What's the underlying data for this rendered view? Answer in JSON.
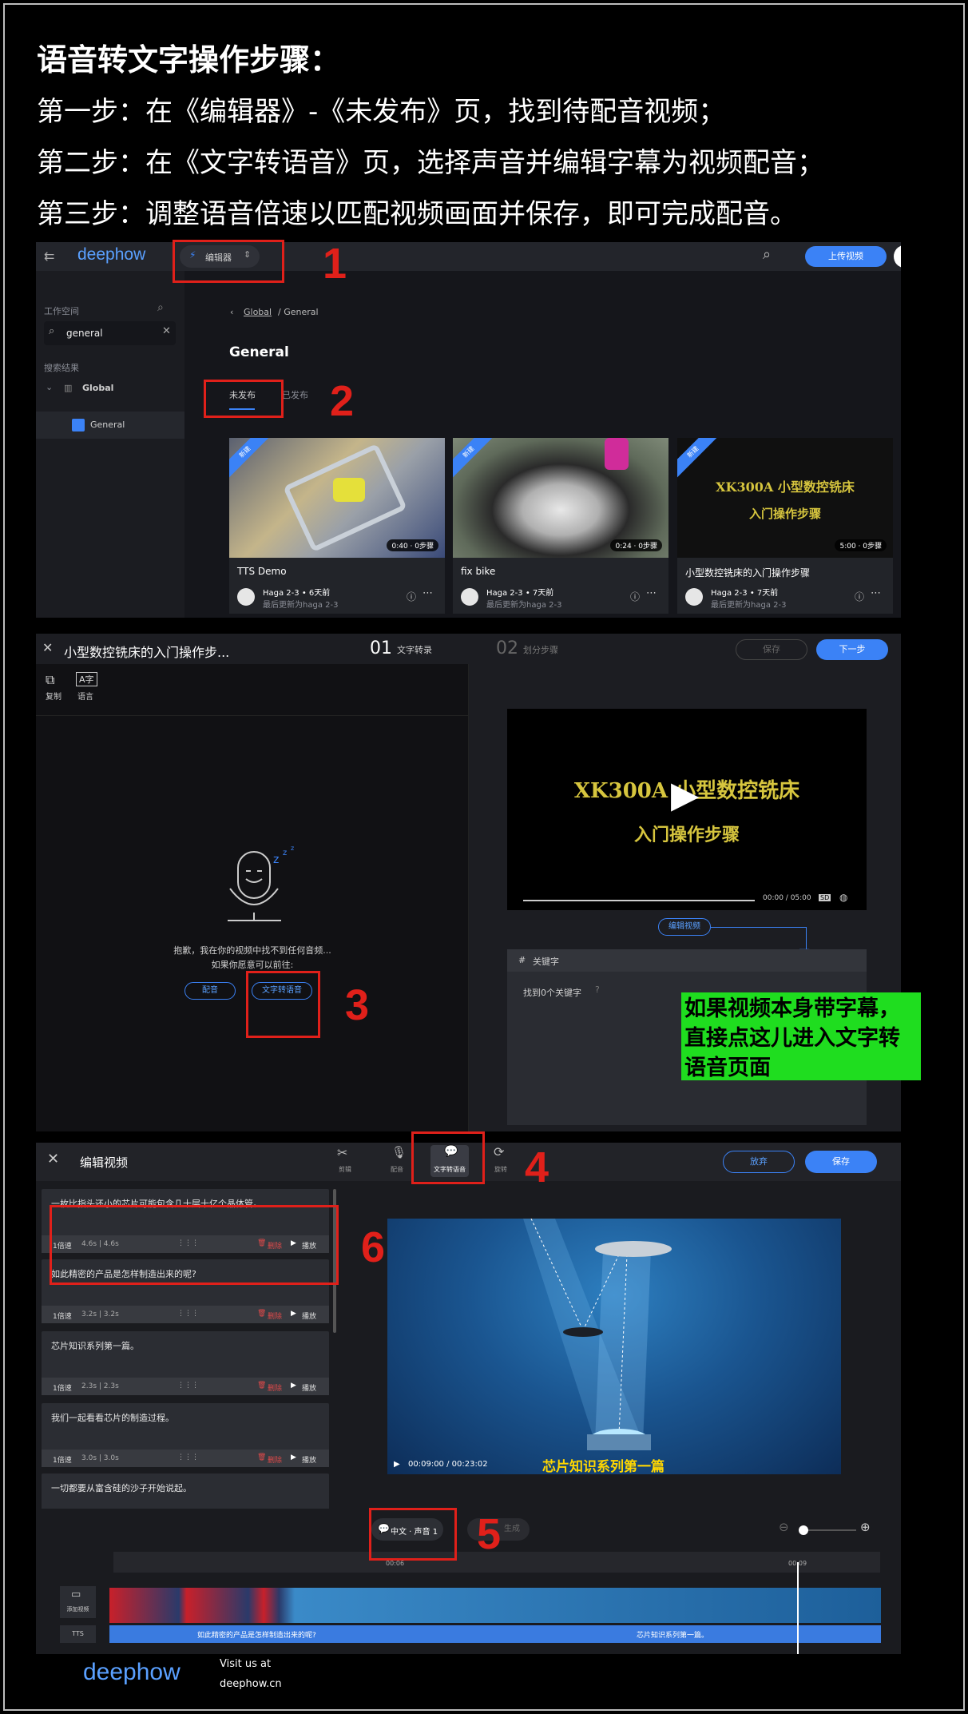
{
  "header": {
    "title": "语音转文字操作步骤：",
    "steps": [
      "第一步：在《编辑器》-《未发布》页，找到待配音视频；",
      "第二步：在《文字转语音》页，选择声音并编辑字幕为视频配音；",
      "第三步：调整语音倍速以匹配视频画面并保存，即可完成配音。"
    ]
  },
  "callouts": [
    "1",
    "2",
    "3",
    "4",
    "5",
    "6"
  ],
  "shot1": {
    "logo": "deephow",
    "editor_label": "编辑器",
    "upload_label": "上传视频",
    "workspace_label": "工作空间",
    "search_value": "general",
    "results_label": "搜索结果",
    "tree_global": "Global",
    "tree_general": "General",
    "breadcrumb_root": "Global",
    "breadcrumb_leaf": "/ General",
    "page_title": "General",
    "tab_unpublished": "未发布",
    "tab_published": "已发布",
    "cards": [
      {
        "title": "TTS Demo",
        "duration": "0:40 · 0步骤",
        "meta1": "Haga 2-3 • 6天前",
        "meta2": "最后更新为haga 2-3",
        "ribbon": "新建"
      },
      {
        "title": "fix bike",
        "duration": "0:24 · 0步骤",
        "meta1": "Haga 2-3 • 7天前",
        "meta2": "最后更新为haga 2-3",
        "ribbon": "新建"
      },
      {
        "title": "小型数控铣床的入门操作步骤",
        "duration": "5:00 · 0步骤",
        "meta1": "Haga 2-3 • 7天前",
        "meta2": "最后更新为haga 2-3",
        "ribbon": "新建",
        "thumb_line1": "XK300A 小型数控铣床",
        "thumb_line2": "入门操作步骤"
      }
    ]
  },
  "shot2": {
    "title": "小型数控铣床的入门操作步...",
    "step1_num": "01",
    "step1_label": "文字转录",
    "step2_num": "02",
    "step2_label": "划分步骤",
    "save_label": "保存",
    "next_label": "下一步",
    "copy_label": "复制",
    "lang_label": "语言",
    "empty_line1": "抱歉，我在你的视频中找不到任何音频...",
    "empty_line2": "如果你愿意可以前往:",
    "dub_label": "配音",
    "tts_label": "文字转语音",
    "video_line1": "XK300A 小型数控铣床",
    "video_line2": "入门操作步骤",
    "video_time": "00:00 / 05:00",
    "edit_video_label": "编辑视频",
    "keywords_title": "关键字",
    "keywords_found": "找到0个关键字"
  },
  "green_note": "如果视频本身带字幕，直接点这儿进入文字转语音页面",
  "shot3": {
    "title": "编辑视频",
    "tools": [
      "剪辑",
      "配音",
      "文字转语音",
      "旋转"
    ],
    "discard_label": "放弃",
    "save_label": "保存",
    "segments": [
      {
        "text": "一枚比指头还小的芯片可能包含几十层十亿个晶体管。",
        "speed": "1倍速",
        "dur": "4.6s | 4.6s"
      },
      {
        "text": "如此精密的产品是怎样制造出来的呢?",
        "speed": "1倍速",
        "dur": "3.2s | 3.2s"
      },
      {
        "text": "芯片知识系列第一篇。",
        "speed": "1倍速",
        "dur": "2.3s | 2.3s"
      },
      {
        "text": "我们一起看看芯片的制造过程。",
        "speed": "1倍速",
        "dur": "3.0s | 3.0s"
      },
      {
        "text": "一切都要从富含硅的沙子开始说起。",
        "speed": "",
        "dur": ""
      }
    ],
    "delete_label": "删除",
    "play_label": "播放",
    "video_time": "00:09:00 / 00:23:02",
    "subtitle": "芯片知识系列第一篇",
    "voice_label": "中文 · 声音 1",
    "generate_label": "生成",
    "tick1": "00:06",
    "tick2": "00:09",
    "add_video_label": "添加视频",
    "tts_track": "TTS",
    "track_text1": "如此精密的产品是怎样制造出来的呢?",
    "track_text2": "芯片知识系列第一篇。"
  },
  "footer": {
    "logo": "deephow",
    "visit": "Visit us at",
    "url": "deephow.cn"
  }
}
